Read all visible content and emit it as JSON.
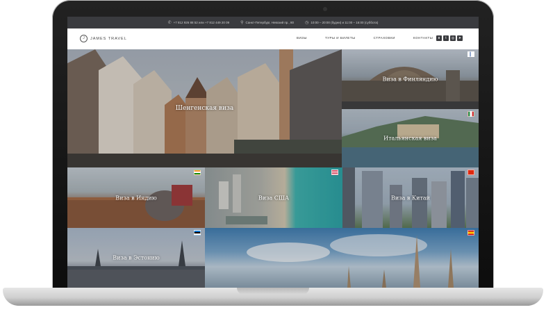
{
  "topbar": {
    "phone": "+7 812 926 88 52 или +7 812 449 20 09",
    "address": "Санкт-Петербург, Невский пр., 80",
    "hours": "10:00 – 20:00 (будни) и 11:00 – 16:00 (суббота)"
  },
  "navbar": {
    "logo": "JAMES TRAVEL",
    "menu": [
      "ВИЗЫ",
      "ТУРЫ И БИЛЕТЫ",
      "СТРАХОВКИ",
      "КОНТАКТЫ"
    ],
    "social_icons": [
      "vk-icon",
      "twitter-icon",
      "instagram-icon",
      "telegram-icon"
    ]
  },
  "tiles": {
    "schengen": "Шенгенская виза",
    "finland": "Виза в Финляндию",
    "italy": "Итальянская виза",
    "india": "Виза в Индию",
    "usa": "Виза США",
    "china": "Виза в Китай",
    "estonia": "Виза в Эстонию",
    "spain": ""
  },
  "colors": {
    "topbar": "#3a3b3f",
    "navbar": "#ffffff",
    "laptop_bezel": "#111111",
    "laptop_base": "#d0d0d0"
  }
}
